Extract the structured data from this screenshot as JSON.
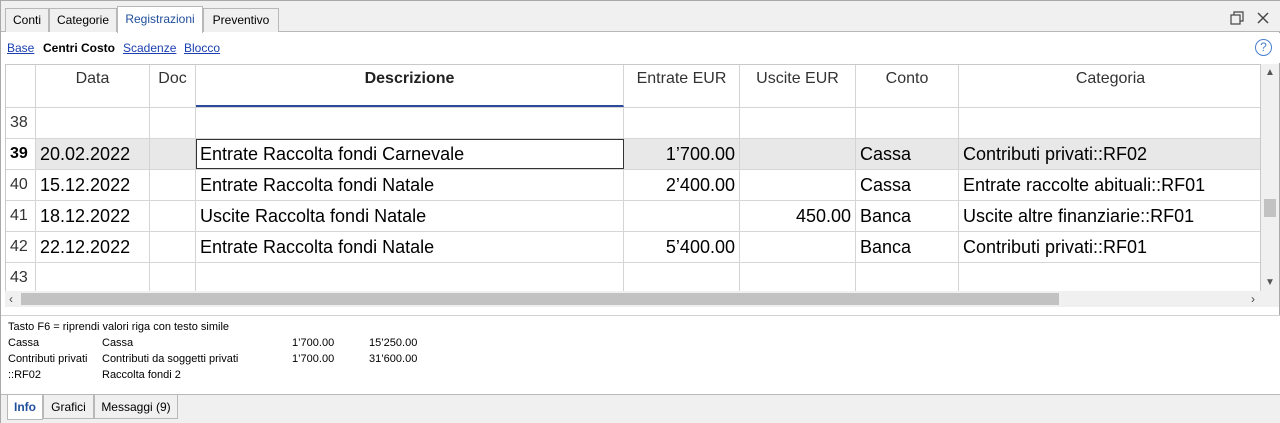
{
  "tabs": [
    "Conti",
    "Categorie",
    "Registrazioni",
    "Preventivo"
  ],
  "active_tab": "Registrazioni",
  "sublinks": [
    "Base",
    "Centri Costo",
    "Scadenze",
    "Blocco"
  ],
  "active_sublink": "Centri Costo",
  "help_label": "?",
  "columns": [
    "Data",
    "Doc",
    "Descrizione",
    "Entrate EUR",
    "Uscite EUR",
    "Conto",
    "Categoria"
  ],
  "rows": [
    {
      "num": "38",
      "data": "",
      "doc": "",
      "descrizione": "",
      "entrate": "",
      "uscite": "",
      "conto": "",
      "categoria": ""
    },
    {
      "num": "39",
      "data": "20.02.2022",
      "doc": "",
      "descrizione": "Entrate Raccolta fondi Carnevale",
      "entrate": "1’700.00",
      "uscite": "",
      "conto": "Cassa",
      "categoria": "Contributi privati::RF02"
    },
    {
      "num": "40",
      "data": "15.12.2022",
      "doc": "",
      "descrizione": "Entrate Raccolta fondi Natale",
      "entrate": "2’400.00",
      "uscite": "",
      "conto": "Cassa",
      "categoria": "Entrate raccolte abituali::RF01"
    },
    {
      "num": "41",
      "data": "18.12.2022",
      "doc": "",
      "descrizione": "Uscite Raccolta fondi Natale",
      "entrate": "",
      "uscite": "450.00",
      "conto": "Banca",
      "categoria": "Uscite altre finanziarie::RF01"
    },
    {
      "num": "42",
      "data": "22.12.2022",
      "doc": "",
      "descrizione": "Entrate Raccolta fondi Natale",
      "entrate": "5’400.00",
      "uscite": "",
      "conto": "Banca",
      "categoria": "Contributi privati::RF01"
    },
    {
      "num": "43",
      "data": "",
      "doc": "",
      "descrizione": "",
      "entrate": "",
      "uscite": "",
      "conto": "",
      "categoria": ""
    }
  ],
  "selected_row": "39",
  "info": {
    "hint": "Tasto F6 = riprendi valori riga con testo simile",
    "lines": [
      {
        "c1": "Cassa",
        "c2": "Cassa",
        "c3": "1’700.00",
        "c4": "15’250.00"
      },
      {
        "c1": "Contributi privati",
        "c2": "Contributi da soggetti privati",
        "c3": "1’700.00",
        "c4": "31’600.00"
      },
      {
        "c1": "::RF02",
        "c2": "Raccolta fondi 2",
        "c3": "",
        "c4": ""
      }
    ]
  },
  "bottom_tabs": [
    "Info",
    "Grafici",
    "Messaggi (9)"
  ],
  "active_bottom_tab": "Info",
  "icons": {
    "restore": "restore-window-icon",
    "close": "close-icon",
    "help": "help-icon"
  }
}
